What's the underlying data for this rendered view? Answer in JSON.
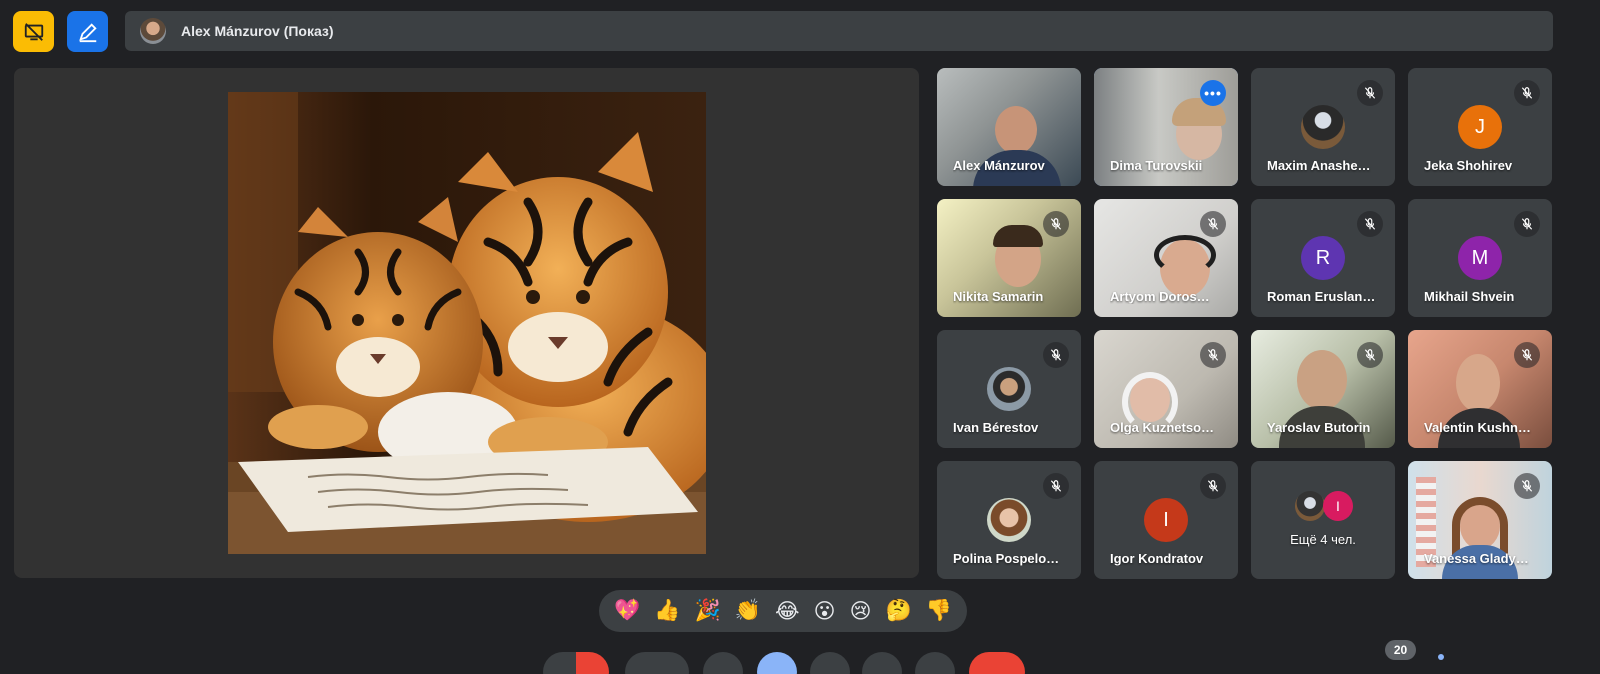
{
  "presenter": {
    "name": "Alex Mánzurov (Показ)"
  },
  "participants": [
    {
      "name": "Alex Mánzurov",
      "muted": false,
      "video": true
    },
    {
      "name": "Dima Turovskii",
      "muted": false,
      "video": true,
      "active": true
    },
    {
      "name": "Maxim Anashe…",
      "muted": true,
      "video": false
    },
    {
      "name": "Jeka Shohirev",
      "muted": true,
      "video": false,
      "initial": "J",
      "color": "#e8710a"
    },
    {
      "name": "Nikita Samarin",
      "muted": true,
      "video": true
    },
    {
      "name": "Artyom Doros…",
      "muted": true,
      "video": true
    },
    {
      "name": "Roman Eruslan…",
      "muted": true,
      "video": false,
      "initial": "R",
      "color": "#5e35b1"
    },
    {
      "name": "Mikhail Shvein",
      "muted": true,
      "video": false,
      "initial": "M",
      "color": "#8e24aa"
    },
    {
      "name": "Ivan Bérestov",
      "muted": true,
      "video": false
    },
    {
      "name": "Olga Kuznetso…",
      "muted": true,
      "video": true
    },
    {
      "name": "Yaroslav Butorin",
      "muted": true,
      "video": true
    },
    {
      "name": "Valentin Kushn…",
      "muted": true,
      "video": true
    },
    {
      "name": "Polina Pospelo…",
      "muted": true,
      "video": false
    },
    {
      "name": "Igor Kondratov",
      "muted": true,
      "video": false,
      "initial": "I",
      "color": "#c5391a"
    },
    {
      "name": "Ещё 4 чел.",
      "muted": false,
      "video": false,
      "overflow": true,
      "initial": "I",
      "color": "#d81b60"
    },
    {
      "name": "Vanessa Glady…",
      "muted": true,
      "video": true
    }
  ],
  "reactions": [
    "💖",
    "👍",
    "🎉",
    "👏",
    "😂",
    "😮",
    "😢",
    "🤔",
    "👎"
  ],
  "participant_count": "20",
  "colors": {
    "background": "#202124",
    "tile": "#3c4043",
    "accent": "#1a73e8",
    "active_outline": "#8ab4f8"
  }
}
